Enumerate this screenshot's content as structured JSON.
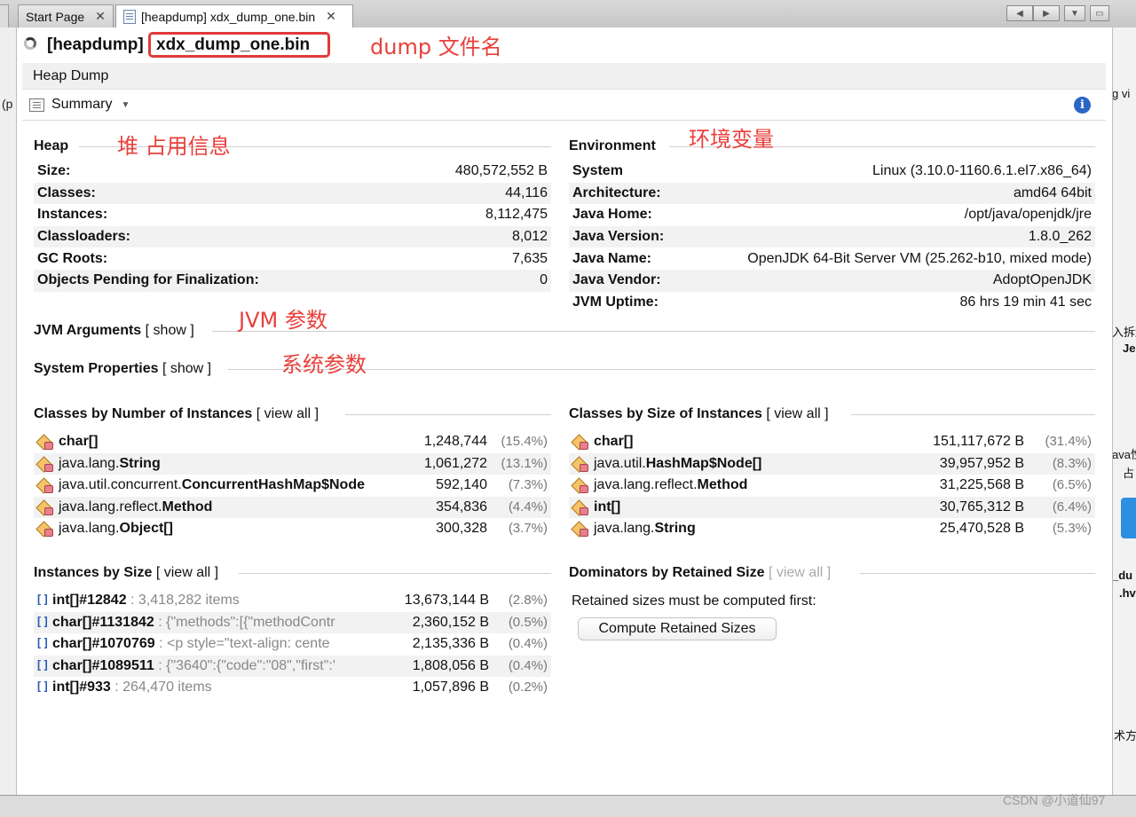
{
  "tabs": [
    {
      "label": "Start Page",
      "close": "✕"
    },
    {
      "label": "[heapdump] xdx_dump_one.bin",
      "close": "✕"
    }
  ],
  "header": {
    "prefix": "[heapdump]",
    "filename": "xdx_dump_one.bin"
  },
  "annotations": {
    "dump_name": "dump 文件名",
    "heap": "堆 占用信息",
    "env": "环境变量",
    "jvm": "JVM 参数",
    "sys": "系统参数"
  },
  "heapdump_bar": "Heap Dump",
  "summary_button": "Summary",
  "info_icon": "i",
  "heap": {
    "title": "Heap",
    "rows": [
      {
        "k": "Size:",
        "v": "480,572,552 B"
      },
      {
        "k": "Classes:",
        "v": "44,116"
      },
      {
        "k": "Instances:",
        "v": "8,112,475"
      },
      {
        "k": "Classloaders:",
        "v": "8,012"
      },
      {
        "k": "GC Roots:",
        "v": "7,635"
      },
      {
        "k": "Objects Pending for Finalization:",
        "v": "0"
      }
    ]
  },
  "environment": {
    "title": "Environment",
    "rows": [
      {
        "k": "System",
        "v": "Linux (3.10.0-1160.6.1.el7.x86_64)"
      },
      {
        "k": "Architecture:",
        "v": "amd64 64bit"
      },
      {
        "k": "Java Home:",
        "v": "/opt/java/openjdk/jre"
      },
      {
        "k": "Java Version:",
        "v": "1.8.0_262"
      },
      {
        "k": "Java Name:",
        "v": "OpenJDK 64-Bit Server VM (25.262-b10, mixed mode)"
      },
      {
        "k": "Java Vendor:",
        "v": "AdoptOpenJDK"
      },
      {
        "k": "JVM Uptime:",
        "v": "86 hrs 19 min 41 sec"
      }
    ]
  },
  "jvm_args": {
    "title": "JVM Arguments",
    "link": "[ show ]"
  },
  "sys_props": {
    "title": "System Properties",
    "link": "[ show ]"
  },
  "classes_by_count": {
    "title": "Classes by Number of Instances",
    "link": "[ view all ]",
    "rows": [
      {
        "pkg": "",
        "cls": "char[]",
        "count": "1,248,744",
        "pct": "(15.4%)"
      },
      {
        "pkg": "java.lang.",
        "cls": "String",
        "count": "1,061,272",
        "pct": "(13.1%)"
      },
      {
        "pkg": "java.util.concurrent.",
        "cls": "ConcurrentHashMap$Node",
        "count": "592,140",
        "pct": "(7.3%)"
      },
      {
        "pkg": "java.lang.reflect.",
        "cls": "Method",
        "count": "354,836",
        "pct": "(4.4%)"
      },
      {
        "pkg": "java.lang.",
        "cls": "Object[]",
        "count": "300,328",
        "pct": "(3.7%)"
      }
    ]
  },
  "classes_by_size": {
    "title": "Classes by Size of Instances",
    "link": "[ view all ]",
    "rows": [
      {
        "pkg": "",
        "cls": "char[]",
        "size": "151,117,672 B",
        "pct": "(31.4%)"
      },
      {
        "pkg": "java.util.",
        "cls": "HashMap$Node[]",
        "size": "39,957,952 B",
        "pct": "(8.3%)"
      },
      {
        "pkg": "java.lang.reflect.",
        "cls": "Method",
        "size": "31,225,568 B",
        "pct": "(6.5%)"
      },
      {
        "pkg": "",
        "cls": "int[]",
        "size": "30,765,312 B",
        "pct": "(6.4%)"
      },
      {
        "pkg": "java.lang.",
        "cls": "String",
        "size": "25,470,528 B",
        "pct": "(5.3%)"
      }
    ]
  },
  "instances_by_size": {
    "title": "Instances by Size",
    "link": "[ view all ]",
    "icon": "[]",
    "rows": [
      {
        "name": "int[]#12842",
        "detail": " : 3,418,282 items",
        "size": "13,673,144 B",
        "pct": "(2.8%)"
      },
      {
        "name": "char[]#1131842",
        "detail": " : {\"methods\":[{\"methodContr",
        "size": "2,360,152 B",
        "pct": "(0.5%)"
      },
      {
        "name": "char[]#1070769",
        "detail": " : <p style=\"text-align: cente",
        "size": "2,135,336 B",
        "pct": "(0.4%)"
      },
      {
        "name": "char[]#1089511",
        "detail": " : {\"3640\":{\"code\":\"08\",\"first\":'",
        "size": "1,808,056 B",
        "pct": "(0.4%)"
      },
      {
        "name": "int[]#933",
        "detail": " : 264,470 items",
        "size": "1,057,896 B",
        "pct": "(0.2%)"
      }
    ]
  },
  "dominators": {
    "title": "Dominators by Retained Size",
    "link": "[ view all ]",
    "message": "Retained sizes must be computed first:",
    "button": "Compute Retained Sizes"
  },
  "side_fragments": {
    "left": [
      "(p"
    ],
    "right": [
      "g vi",
      "入拆解",
      "Je",
      "ava性",
      "占",
      "_du",
      ".hv",
      "术方"
    ]
  },
  "watermark": "CSDN @小道仙97"
}
